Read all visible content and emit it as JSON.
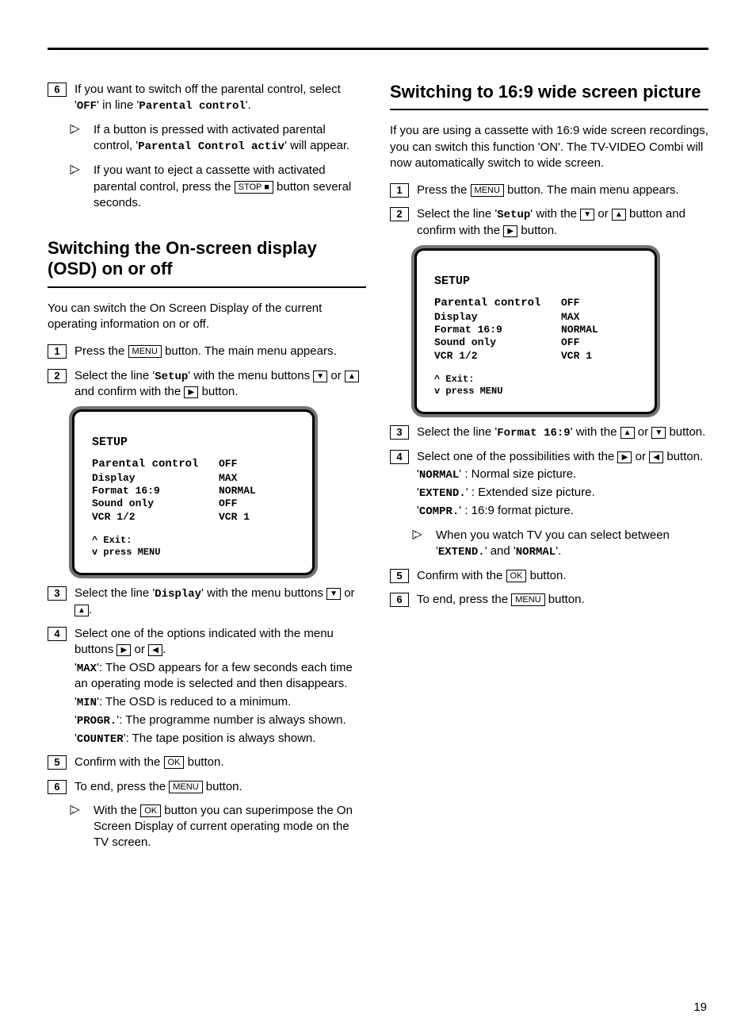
{
  "pageNumber": "19",
  "buttons": {
    "menu": "MENU",
    "stop": "STOP ■",
    "ok": "OK",
    "up": "▲",
    "down": "▼",
    "left": "◀",
    "right": "▶"
  },
  "mono": {
    "off": "OFF",
    "parentalControl": "Parental control",
    "parentalControlActiv": "Parental Control activ",
    "setup": "Setup",
    "display": "Display",
    "max": "MAX",
    "min": "MIN",
    "progr": "PROGR.",
    "counter": "COUNTER",
    "format169": "Format 16:9",
    "normal": "NORMAL",
    "extend": "EXTEND.",
    "compr": "COMPR."
  },
  "left": {
    "parental": {
      "step6": {
        "num": "6",
        "prefix": "If you want to switch off the parental control, select '",
        "mid": "' in line '",
        "suffix": "'."
      },
      "tip1": {
        "prefix": "If a button is pressed with activated parental control, '",
        "suffix": "' will appear."
      },
      "tip2": {
        "prefix": "If you want to eject a cassette with activated parental control, press the ",
        "suffix": " button several seconds."
      }
    },
    "osdSection": {
      "heading": "Switching the On-screen display (OSD) on or off",
      "intro": "You can switch the On Screen Display of the current operating information on or off.",
      "step1": {
        "num": "1",
        "prefix": "Press the ",
        "suffix": " button. The main menu appears."
      },
      "step2": {
        "num": "2",
        "prefix": "Select the line '",
        "mid": "' with the menu buttons ",
        "or": " or ",
        "confirm": " and confirm with the ",
        "suffix": " button."
      },
      "step3": {
        "num": "3",
        "prefix": "Select the line '",
        "mid": "' with the menu buttons ",
        "or": "or ",
        "suffix": "."
      },
      "step4": {
        "num": "4",
        "head": "Select one of the options indicated with the menu buttons ",
        "or": " or ",
        "end": ".",
        "maxDesc": ": The OSD appears for a few seconds each time an operating mode is selected and then disappears.",
        "minDesc": ": The OSD is reduced to a minimum.",
        "progrDesc": ": The programme number is always shown.",
        "counterDesc": ": The tape position is always shown."
      },
      "step5": {
        "num": "5",
        "prefix": "Confirm with the ",
        "suffix": " button."
      },
      "step6": {
        "num": "6",
        "prefix": "To end, press the ",
        "suffix": " button."
      },
      "tip": {
        "prefix": "With the ",
        "suffix": " button you can superimpose the On Screen Display of current operating mode on the TV screen."
      }
    }
  },
  "right": {
    "heading": "Switching to 16:9 wide screen picture",
    "intro": "If you are using a cassette with 16:9 wide screen recordings, you can switch this function 'ON'. The TV-VIDEO Combi will now automatically switch to wide screen.",
    "step1": {
      "num": "1",
      "prefix": "Press the ",
      "suffix": " button. The main menu appears."
    },
    "step2": {
      "num": "2",
      "prefix": "Select the line '",
      "mid": "' with the ",
      "or": " or ",
      "confirm": " button and confirm with the ",
      "suffix": " button."
    },
    "step3": {
      "num": "3",
      "prefix": "Select the line '",
      "mid": "' with the ",
      "or": " or ",
      "suffix": " button."
    },
    "step4": {
      "num": "4",
      "head": "Select one of the possibilities with the ",
      "or": " or ",
      "end": " button.",
      "normalDesc": " : Normal size picture.",
      "extendDesc": " : Extended size picture.",
      "comprDesc": " : 16:9 format picture."
    },
    "tip": {
      "prefix": "When you watch TV you can select between '",
      "and": "' and '",
      "suffix": "'."
    },
    "step5": {
      "num": "5",
      "prefix": "Confirm with the ",
      "suffix": " button."
    },
    "step6": {
      "num": "6",
      "prefix": "To end, press the ",
      "suffix": " button."
    }
  },
  "osdScreen": {
    "title": "SETUP",
    "rows": [
      {
        "k": "Parental control",
        "v": "OFF"
      },
      {
        "k": "Display",
        "v": "MAX"
      },
      {
        "k": "Format 16:9",
        "v": "NORMAL"
      },
      {
        "k": "Sound only",
        "v": "OFF"
      },
      {
        "k": "VCR 1/2",
        "v": "VCR 1"
      }
    ],
    "exit1": "^ Exit:",
    "exit2": "v press MENU"
  }
}
